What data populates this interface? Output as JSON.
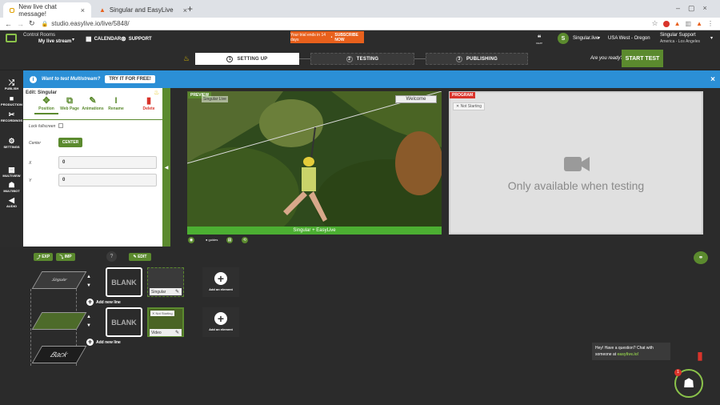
{
  "browser": {
    "tabs": [
      {
        "label": "New live chat message!",
        "active": true
      },
      {
        "label": "Singular and EasyLive",
        "active": false
      }
    ],
    "url": "studio.easylive.io/live/5848/"
  },
  "header": {
    "brand_line1": "Control Rooms",
    "brand_line2": "My live stream",
    "calendar": "CALENDAR",
    "support": "SUPPORT",
    "trial_text": "Your trial ends in 14 days",
    "subscribe": "SUBSCRIBE NOW",
    "chat_label": "CHAT",
    "account_initial": "S",
    "account_name": "Singular.live",
    "region": "USA West - Oregon",
    "user_name": "Singular Support",
    "user_tz": "America - Los Angeles",
    "ready_q": "Are you ready?",
    "start_test": "START TEST",
    "steps": [
      {
        "num": "1",
        "label": "SETTING UP"
      },
      {
        "num": "2",
        "label": "TESTING"
      },
      {
        "num": "3",
        "label": "PUBLISHING"
      }
    ]
  },
  "banner": {
    "text": "Want to test Multistream?",
    "button": "TRY IT FOR FREE!",
    "close": "×"
  },
  "rail": [
    {
      "icon": "shuffle-icon",
      "glyph": "⤮",
      "label": "PUBLISH"
    },
    {
      "icon": "camera-icon",
      "glyph": "■",
      "label": "PRODUCTION"
    },
    {
      "icon": "scissors-icon",
      "glyph": "✂",
      "label": "RECORDINGS"
    },
    {
      "icon": "settings-icon",
      "glyph": "⚙",
      "label": "SETTINGS"
    },
    {
      "icon": "grid-icon",
      "glyph": "▦",
      "label": "MULTIVIEW"
    },
    {
      "icon": "robot-icon",
      "glyph": "☗",
      "label": "MULTIBOT"
    },
    {
      "icon": "speaker-icon",
      "glyph": "◀",
      "label": "AUDIO"
    }
  ],
  "edit": {
    "title": "Edit: Singular",
    "tools": [
      {
        "icon": "move-icon",
        "glyph": "✥",
        "label": "Position"
      },
      {
        "icon": "external-link-icon",
        "glyph": "⧉",
        "label": "Web Page"
      },
      {
        "icon": "magic-wand-icon",
        "glyph": "✎",
        "label": "Animations"
      },
      {
        "icon": "text-cursor-icon",
        "glyph": "I",
        "label": "Rename"
      },
      {
        "icon": "trash-icon",
        "glyph": "▮",
        "label": "Delete"
      }
    ],
    "lock_label": "Lock fullscreen",
    "center_label": "Center",
    "center_button": "CENTER",
    "x_label": "X",
    "x_value": "0",
    "y_label": "Y",
    "y_value": "0"
  },
  "preview": {
    "tag": "PREVIEW",
    "overlay_left": "Singular Live",
    "overlay_right": "Welcome",
    "footer": "Singular + EasyLive",
    "guides": "guides"
  },
  "program": {
    "tag": "PROGRAM",
    "status": "Not Starting",
    "message": "Only available when testing"
  },
  "timeline": {
    "exp": "EXP",
    "imp": "IMP",
    "help": "?",
    "edit": "EDIT",
    "layer_top": "Singular",
    "layer_back": "Back",
    "blank": "BLANK",
    "row1_element": "Singular",
    "row2_element": "Video",
    "row2_badge": "Not Starting",
    "add_element": "Add an element",
    "add_line": "Add new line"
  },
  "chat": {
    "message_prefix": "Hey! Have a question? Chat with someone at ",
    "message_link": "easylive.io!",
    "badge": "1",
    "bot_label": "Live Chat"
  },
  "colors": {
    "green": "#5b8a2e",
    "blue": "#2b8fd6",
    "orange": "#e8601c",
    "red": "#d9342b"
  }
}
